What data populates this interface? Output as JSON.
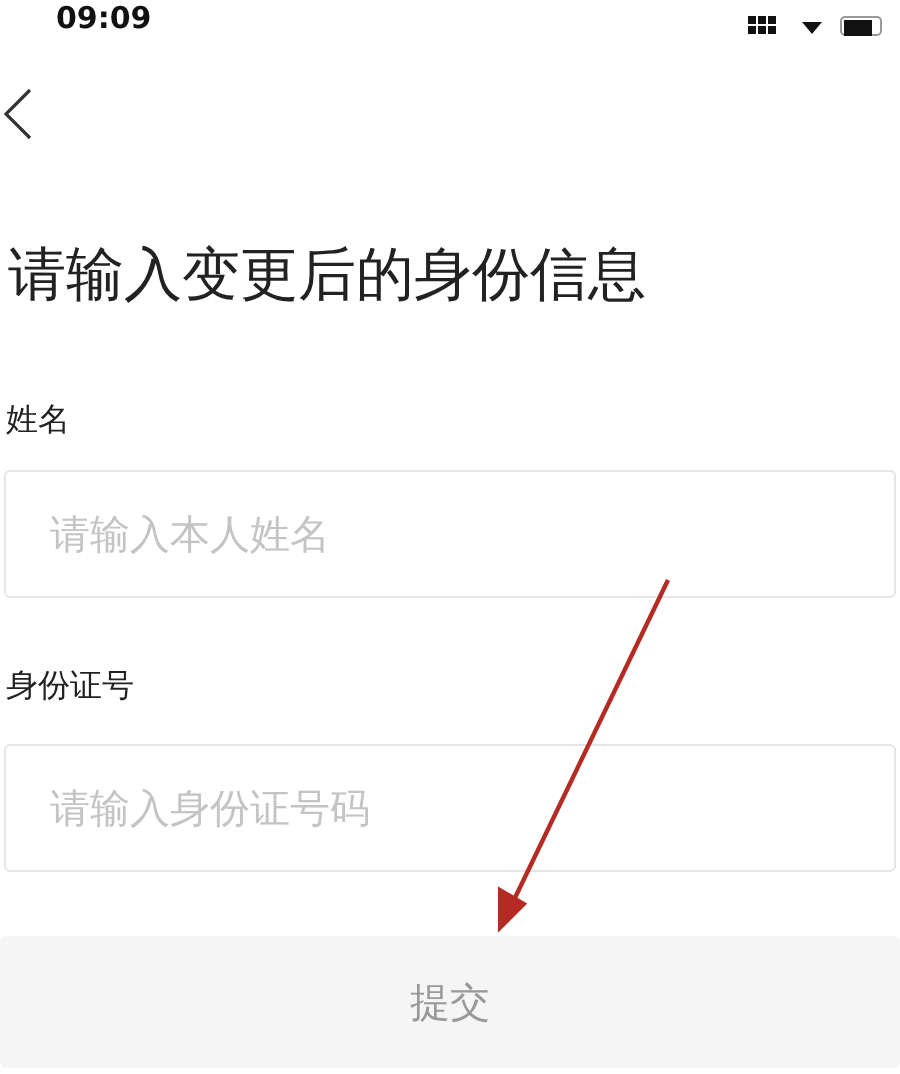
{
  "status_bar": {
    "time": "09:09"
  },
  "title": "请输入变更后的身份信息",
  "fields": [
    {
      "label": "姓名",
      "placeholder": "请输入本人姓名"
    },
    {
      "label": "身份证号",
      "placeholder": "请输入身份证号码"
    }
  ],
  "submit": {
    "label": "提交",
    "disabled": true
  }
}
